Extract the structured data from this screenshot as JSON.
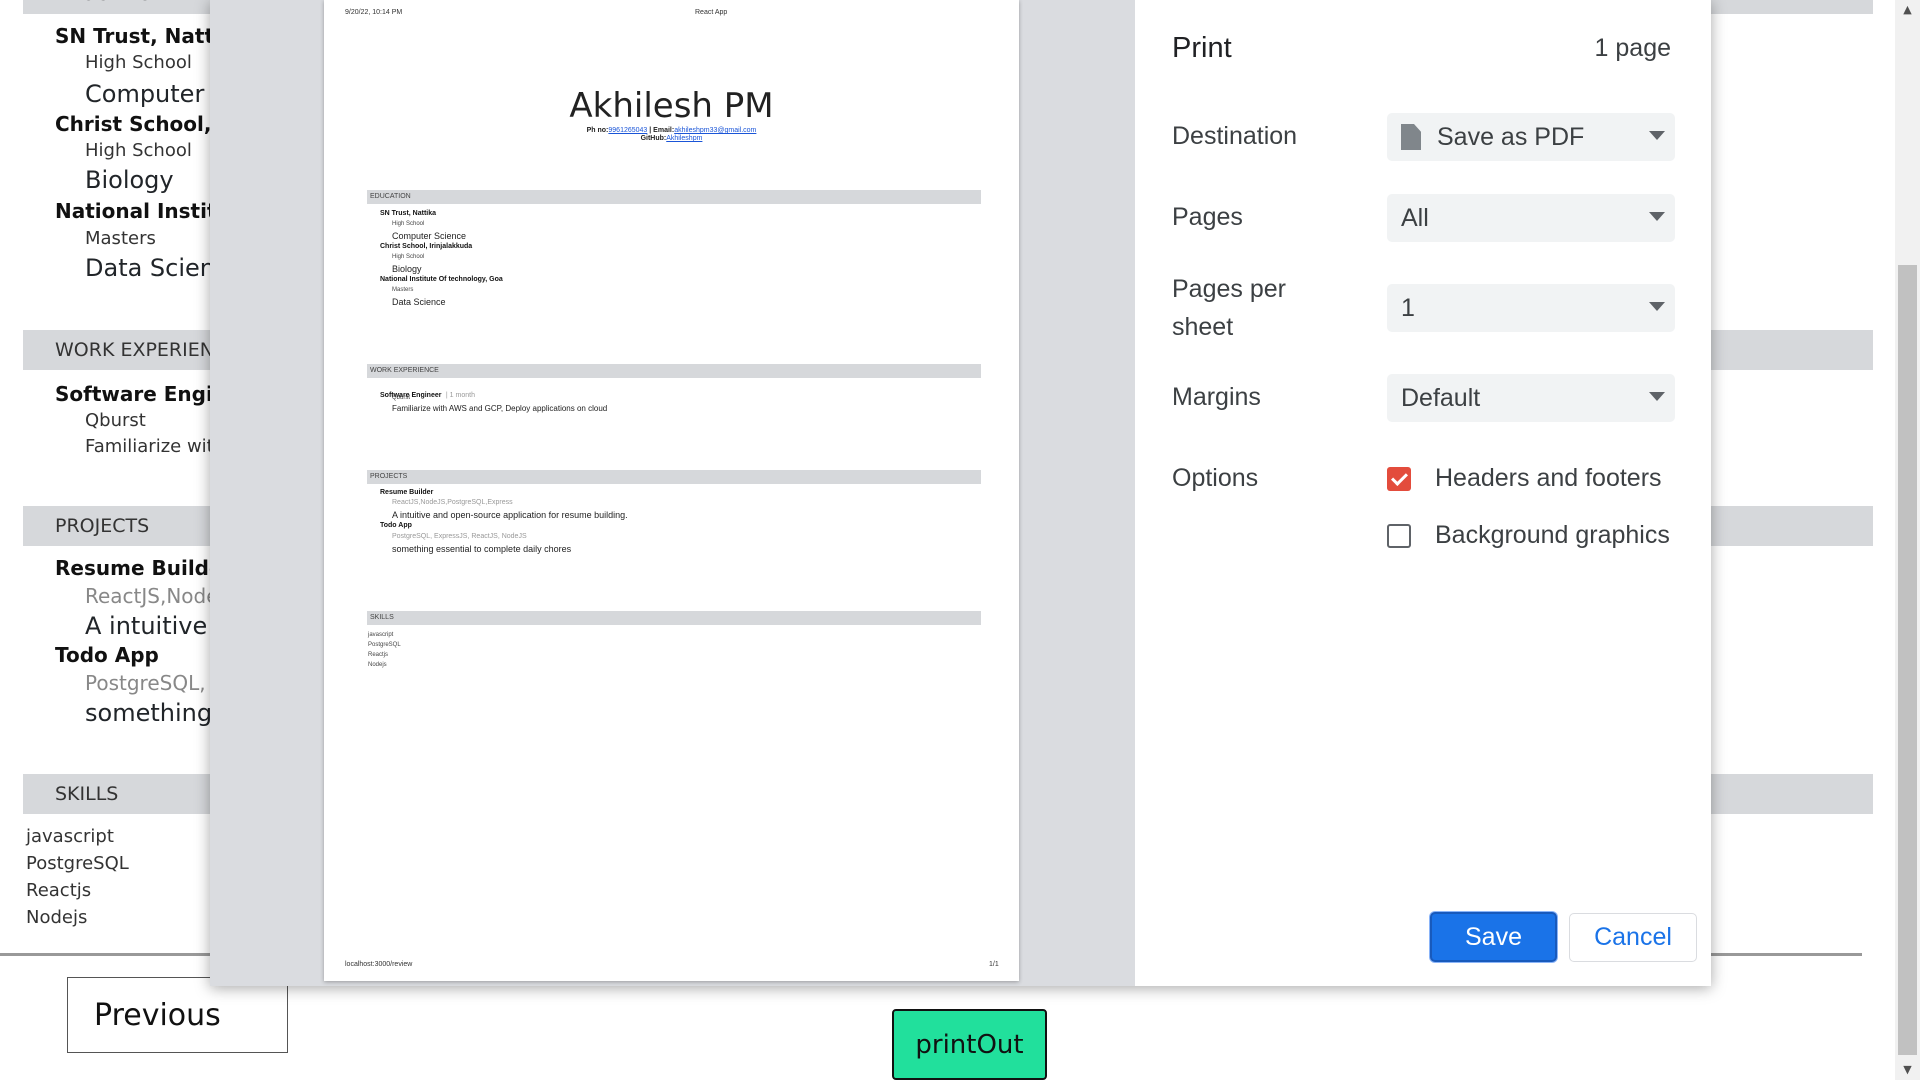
{
  "background": {
    "education_bar": "EDUCATION",
    "work_bar": "WORK EXPERIENCE",
    "projects_bar": "PROJECTS",
    "skills_bar": "SKILLS",
    "education": [
      {
        "school": "SN Trust, Nattika",
        "level": "High School",
        "field": "Computer Science"
      },
      {
        "school": "Christ School, Irinjalakkuda",
        "level": "High School",
        "field": "Biology"
      },
      {
        "school": "National Institute Of technology, Goa",
        "level": "Masters",
        "field": "Data Science"
      }
    ],
    "work": {
      "title": "Software Engineer",
      "company": "Qburst",
      "desc": "Familiarize with AWS and GCP, Deploy applications on cloud"
    },
    "projects": [
      {
        "name": "Resume Builder",
        "stack": "ReactJS,NodeJS,PostgreSQL,Express",
        "desc": "A intuitive and open-source application for resume building."
      },
      {
        "name": "Todo App",
        "stack": "PostgreSQL, ExpressJS, ReactJS, NodeJS",
        "desc": "something essential to complete daily chores"
      }
    ],
    "skills": [
      "javascript",
      "PostgreSQL",
      "Reactjs",
      "Nodejs"
    ],
    "previous_label": "Previous",
    "printout_label": "printOut"
  },
  "preview": {
    "header_left": "9/20/22, 10:14 PM",
    "header_center": "React App",
    "name": "Akhilesh PM",
    "phone_label": "Ph no:",
    "phone": "9961265043",
    "email_label": " | Email:",
    "email": "akhileshpm33@gmail.com",
    "github_label": "GitHub:",
    "github": "Akhileshpm",
    "work_duration": "| 1 month",
    "footer_left": "localhost:3000/review",
    "footer_right": "1/1"
  },
  "print": {
    "title": "Print",
    "page_count": "1 page",
    "destination_label": "Destination",
    "destination_value": "Save as PDF",
    "pages_label": "Pages",
    "pages_value": "All",
    "pages_per_sheet_label": "Pages per sheet",
    "pages_per_sheet_value": "1",
    "margins_label": "Margins",
    "margins_value": "Default",
    "options_label": "Options",
    "headers_footers_label": "Headers and footers",
    "headers_footers_checked": true,
    "background_graphics_label": "Background graphics",
    "background_graphics_checked": false,
    "save_label": "Save",
    "cancel_label": "Cancel"
  },
  "colors": {
    "printout_btn": "#21e09c",
    "save_btn": "#1a73e8",
    "checkbox": "#e34c3c"
  }
}
